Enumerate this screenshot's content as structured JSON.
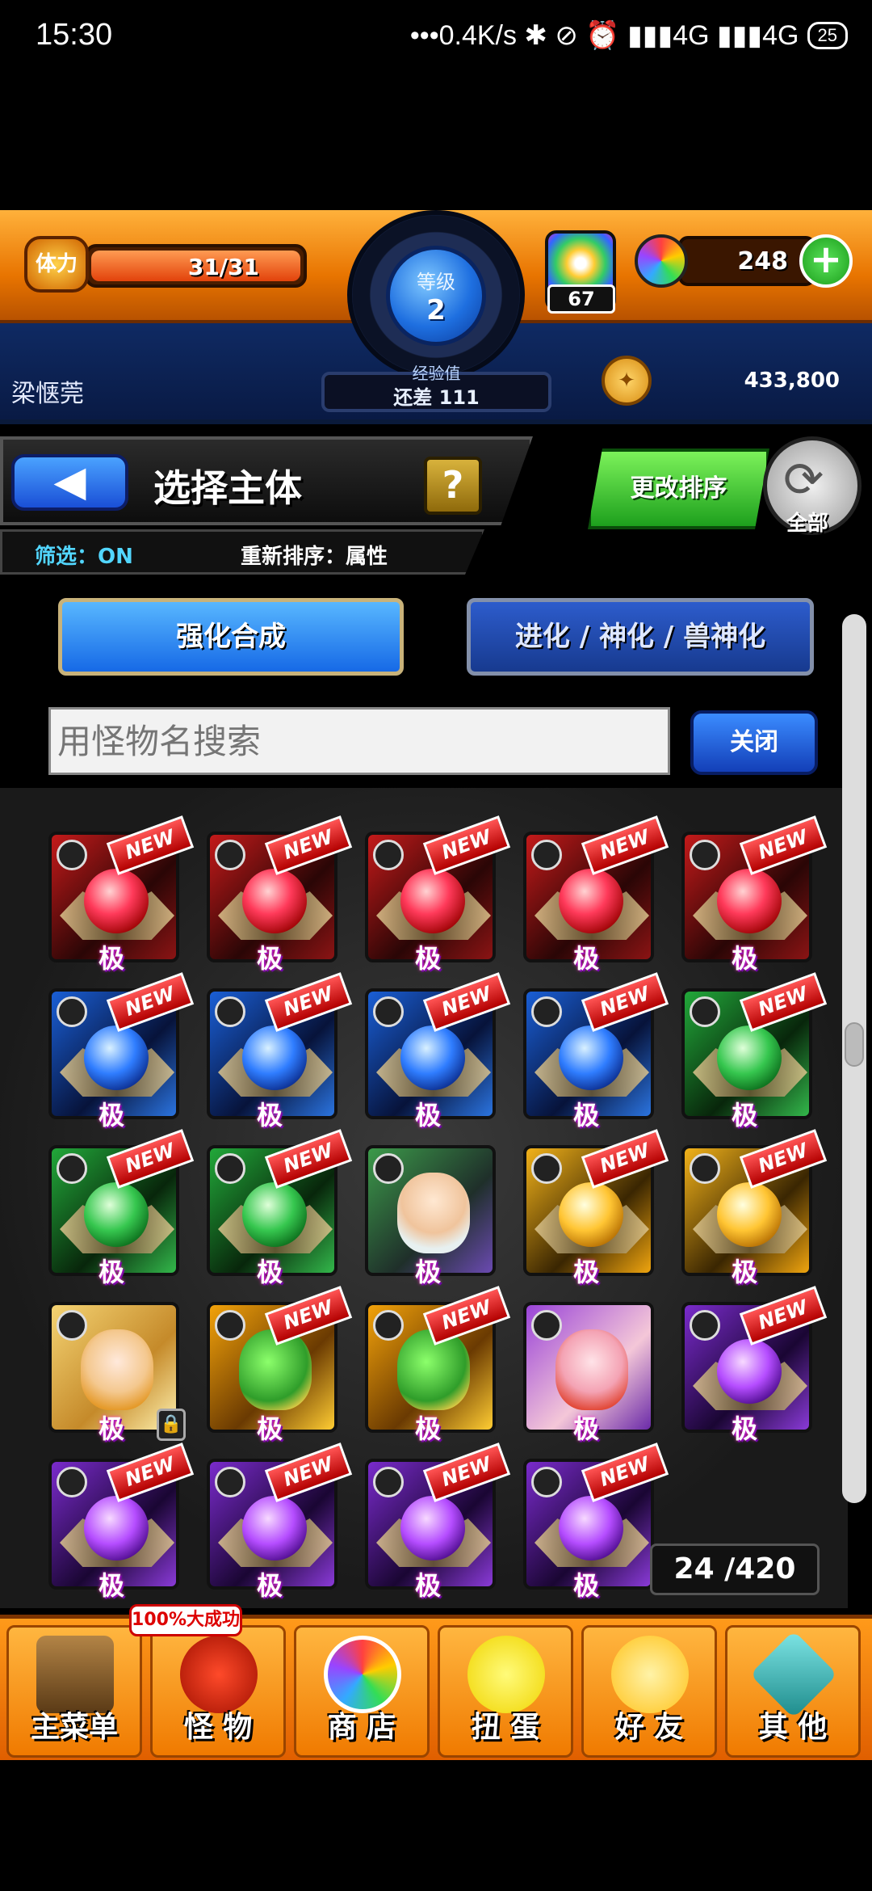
{
  "status_bar": {
    "time": "15:30",
    "indicators": "•••0.4K/s ✱ ⊘ ⏰ ▮▮▮4G ▮▮▮4G",
    "battery": "25"
  },
  "hud": {
    "stamina_label": "体力",
    "stamina_value": "31/31",
    "stamina_fraction": 1.0,
    "level_label": "等级",
    "level_value": "2",
    "exp_label": "经验值",
    "exp_value": "还差 111",
    "potion_count": "67",
    "orb_count": "248",
    "plus_label": "+",
    "username": "梁惬莞",
    "coin_count": "433,800"
  },
  "title_bar": {
    "back_label": "◀",
    "title": "选择主体",
    "help_label": "?",
    "filter_status": "筛选：ON",
    "sort_status": "重新排序：属性",
    "change_sort_label": "更改排序",
    "all_label": "全部"
  },
  "tabs": {
    "active": "强化合成",
    "inactive": "进化 / 神化 / 兽神化"
  },
  "search": {
    "placeholder": "用怪物名搜索",
    "close_label": "关闭"
  },
  "grid": {
    "new_label": "NEW",
    "grade_label": "极",
    "count_label": "24 /420",
    "cells": [
      {
        "type": "fire",
        "new": true
      },
      {
        "type": "fire",
        "new": true
      },
      {
        "type": "fire",
        "new": true
      },
      {
        "type": "fire",
        "new": true
      },
      {
        "type": "fire",
        "new": true
      },
      {
        "type": "water",
        "new": true
      },
      {
        "type": "water",
        "new": true
      },
      {
        "type": "water",
        "new": true
      },
      {
        "type": "water",
        "new": true
      },
      {
        "type": "wood",
        "new": true
      },
      {
        "type": "wood",
        "new": true
      },
      {
        "type": "wood",
        "new": true
      },
      {
        "type": "char-wood",
        "new": false
      },
      {
        "type": "light",
        "new": true
      },
      {
        "type": "light",
        "new": true
      },
      {
        "type": "char-light-girl",
        "new": false,
        "locked": true
      },
      {
        "type": "char-dragon",
        "new": true
      },
      {
        "type": "char-dragon",
        "new": true
      },
      {
        "type": "char-dark-girl",
        "new": false
      },
      {
        "type": "dark",
        "new": true
      },
      {
        "type": "dark",
        "new": true
      },
      {
        "type": "dark",
        "new": true
      },
      {
        "type": "dark",
        "new": true
      },
      {
        "type": "dark",
        "new": true
      }
    ]
  },
  "bottom_nav": {
    "promo": "100%大成功",
    "items": [
      {
        "label": "主菜单",
        "icon": "home-icon"
      },
      {
        "label": "怪 物",
        "icon": "monster-icon"
      },
      {
        "label": "商 店",
        "icon": "shop-icon"
      },
      {
        "label": "扭 蛋",
        "icon": "gacha-icon"
      },
      {
        "label": "好 友",
        "icon": "friends-icon"
      },
      {
        "label": "其 他",
        "icon": "other-icon"
      }
    ]
  }
}
